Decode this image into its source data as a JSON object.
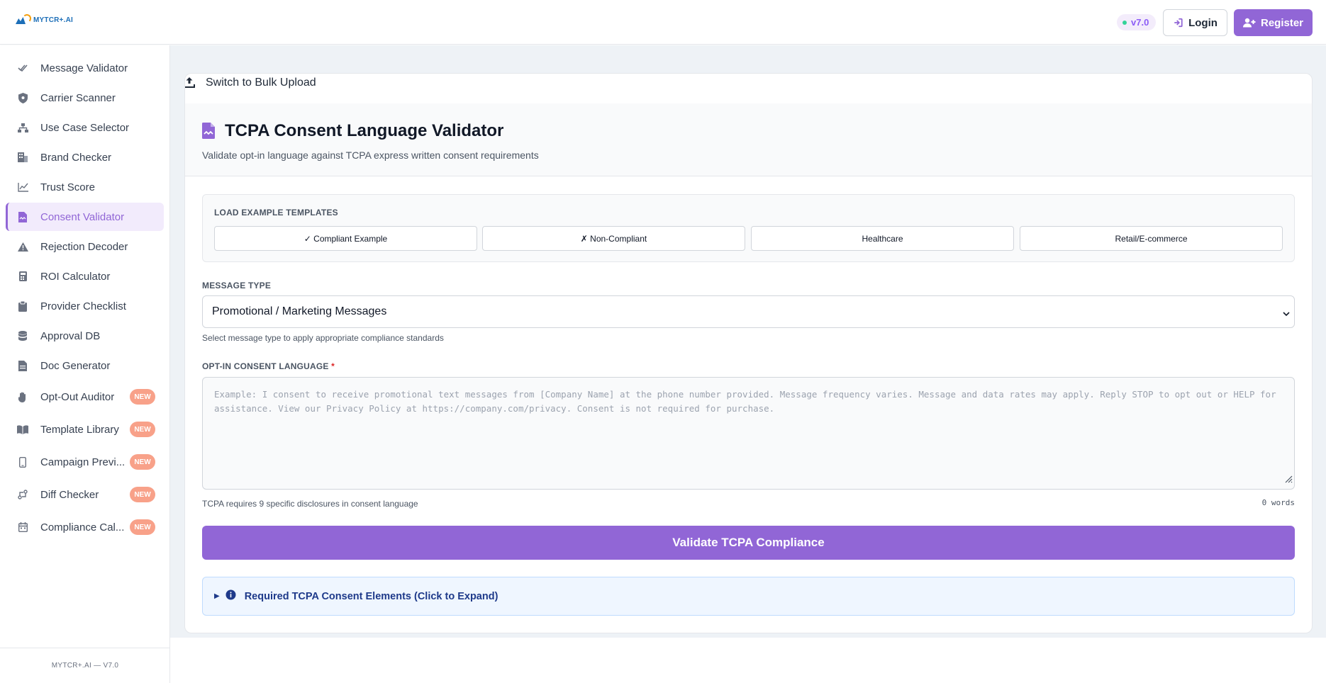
{
  "header": {
    "logo_text": "MYTCR+.AI",
    "version": "v7.0",
    "login_label": "Login",
    "register_label": "Register"
  },
  "sidebar": {
    "items": [
      {
        "label": "Message Validator",
        "icon": "double-check-icon",
        "new": false
      },
      {
        "label": "Carrier Scanner",
        "icon": "shield-icon",
        "new": false
      },
      {
        "label": "Use Case Selector",
        "icon": "sitemap-icon",
        "new": false
      },
      {
        "label": "Brand Checker",
        "icon": "building-icon",
        "new": false
      },
      {
        "label": "Trust Score",
        "icon": "line-chart-icon",
        "new": false
      },
      {
        "label": "Consent Validator",
        "icon": "file-signature-icon",
        "new": false,
        "active": true
      },
      {
        "label": "Rejection Decoder",
        "icon": "warning-icon",
        "new": false
      },
      {
        "label": "ROI Calculator",
        "icon": "calculator-icon",
        "new": false
      },
      {
        "label": "Provider Checklist",
        "icon": "clipboard-icon",
        "new": false
      },
      {
        "label": "Approval DB",
        "icon": "database-icon",
        "new": false
      },
      {
        "label": "Doc Generator",
        "icon": "document-icon",
        "new": false
      },
      {
        "label": "Opt-Out Auditor",
        "icon": "hand-icon",
        "new": true
      },
      {
        "label": "Template Library",
        "icon": "book-icon",
        "new": true
      },
      {
        "label": "Campaign Previ...",
        "icon": "mobile-icon",
        "new": true
      },
      {
        "label": "Diff Checker",
        "icon": "diff-icon",
        "new": true
      },
      {
        "label": "Compliance Cal...",
        "icon": "calendar-icon",
        "new": true
      }
    ],
    "new_badge": "NEW",
    "footer": "MYTCR+.AI — V7.0"
  },
  "main": {
    "bulk_upload_label": "Switch to Bulk Upload",
    "title": "TCPA Consent Language Validator",
    "subtitle": "Validate opt-in language against TCPA express written consent requirements",
    "examples": {
      "label": "LOAD EXAMPLE TEMPLATES",
      "buttons": [
        "✓ Compliant Example",
        "✗ Non-Compliant",
        "Healthcare",
        "Retail/E-commerce"
      ]
    },
    "message_type": {
      "label": "MESSAGE TYPE",
      "selected": "Promotional / Marketing Messages",
      "help": "Select message type to apply appropriate compliance standards"
    },
    "consent": {
      "label": "OPT-IN CONSENT LANGUAGE",
      "required_mark": "*",
      "placeholder": "Example: I consent to receive promotional text messages from [Company Name] at the phone number provided. Message frequency varies. Message and data rates may apply. Reply STOP to opt out or HELP for assistance. View our Privacy Policy at https://company.com/privacy. Consent is not required for purchase.",
      "help": "TCPA requires 9 specific disclosures in consent language",
      "word_count": "0 words"
    },
    "validate_label": "Validate TCPA Compliance",
    "required_elements_label": "Required TCPA Consent Elements (Click to Expand)"
  },
  "colors": {
    "accent": "#9166d6",
    "new_badge": "#f8a189",
    "info_bg": "#eff6ff",
    "info_text": "#1e3a8a"
  }
}
